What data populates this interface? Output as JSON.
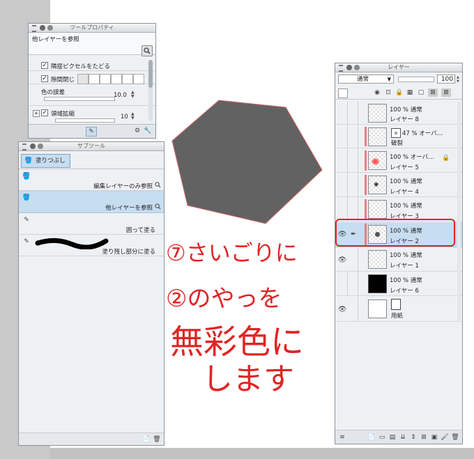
{
  "tool_property": {
    "title": "ツールプロパティ",
    "mode": "他レイヤーを参照",
    "rows": [
      {
        "label": "隣接ピクセルをたどる"
      },
      {
        "label": "隙間閉じ"
      },
      {
        "label": "色の誤差",
        "value": "10.0"
      },
      {
        "label": "領域拡縮",
        "value": "10"
      }
    ]
  },
  "sub_tool": {
    "title": "サブツール",
    "group": "塗りつぶし",
    "items": [
      {
        "label": ""
      },
      {
        "label": "編集レイヤーのみ参照"
      },
      {
        "label": "他レイヤーを参照"
      },
      {
        "label": "囲って塗る"
      },
      {
        "label": "塗り残し部分に塗る"
      }
    ]
  },
  "layer": {
    "title": "レイヤー",
    "blend_mode": "通常",
    "opacity": "100",
    "layers": [
      {
        "mode": "100 % 通常",
        "name": "レイヤー 8"
      },
      {
        "mode": "47 % オーバ…",
        "name": "破裂"
      },
      {
        "mode": "100 % オーバ…",
        "name": "レイヤー 5"
      },
      {
        "mode": "100 % 通常",
        "name": "レイヤー 4"
      },
      {
        "mode": "100 % 通常",
        "name": "レイヤー 3"
      },
      {
        "mode": "100 % 通常",
        "name": "レイヤー 2"
      },
      {
        "mode": "100 % 通常",
        "name": "レイヤー 1"
      },
      {
        "mode": "100 % 通常",
        "name": "レイヤー 6"
      },
      {
        "mode": "",
        "name": "用紙"
      }
    ]
  },
  "handwriting": {
    "line1": "⑦さいごりに",
    "line2": "②のやっを",
    "line3": "無彩色に",
    "line4": "します"
  },
  "colors": {
    "highlight": "#c7ddf0",
    "annotation": "#e02424",
    "hexagon": "#626262"
  }
}
